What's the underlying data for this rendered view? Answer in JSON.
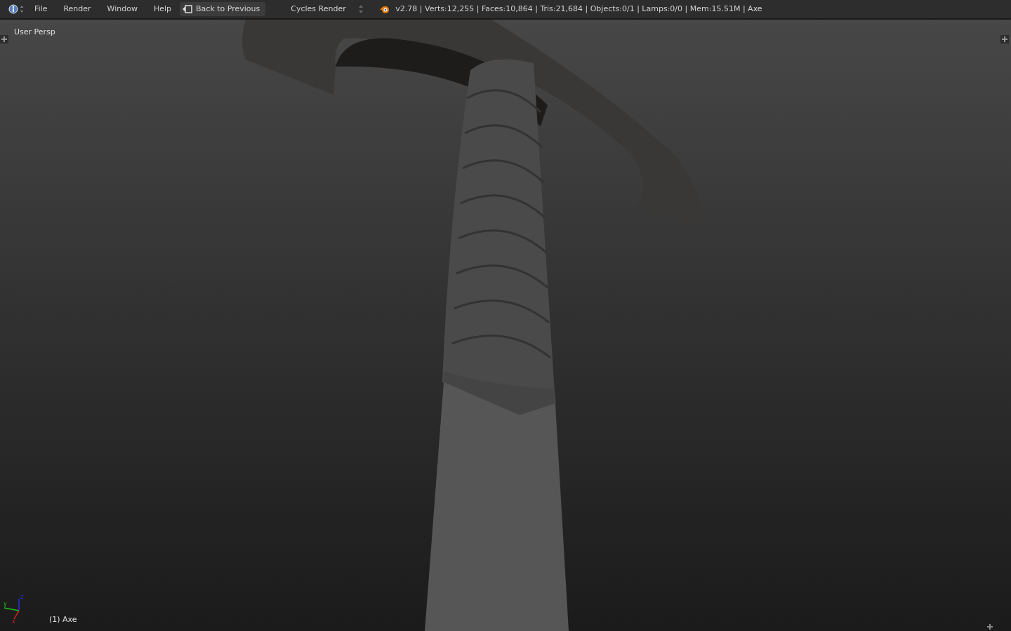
{
  "menu": [
    "File",
    "Render",
    "Window",
    "Help"
  ],
  "back_button": {
    "label": "Back to Previous"
  },
  "render_engine": {
    "value": "Cycles Render"
  },
  "stats": "v2.78 | Verts:12,255 | Faces:10,864 | Tris:21,684 | Objects:0/1 | Lamps:0/0 | Mem:15.51M | Axe",
  "viewport": {
    "view_label": "User Persp",
    "object_label": "(1) Axe",
    "axes": {
      "x": "x",
      "y": "y",
      "z": "z"
    }
  }
}
